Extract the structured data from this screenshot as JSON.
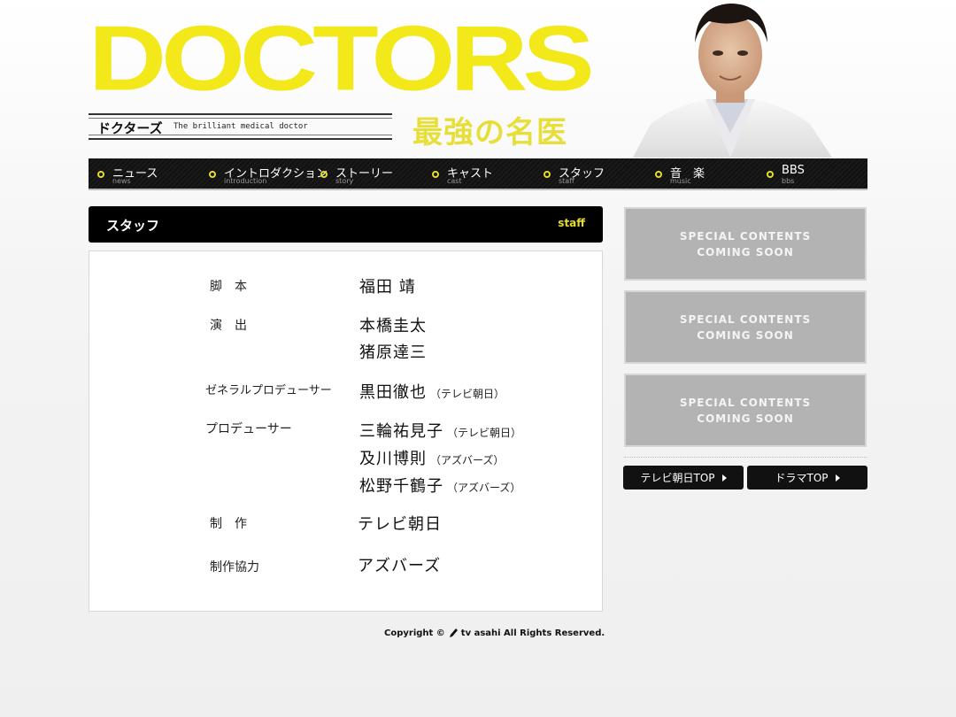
{
  "header": {
    "logo": "DOCTORS",
    "title_jp": "ドクターズ",
    "title_en": "The brilliant medical doctor",
    "subtitle": "最強の名医"
  },
  "nav": [
    {
      "jp": "ニュース",
      "en": "news"
    },
    {
      "jp": "イントロダクション",
      "en": "introduction"
    },
    {
      "jp": "ストーリー",
      "en": "story"
    },
    {
      "jp": "キャスト",
      "en": "cast"
    },
    {
      "jp": "スタッフ",
      "en": "staff"
    },
    {
      "jp": "音　楽",
      "en": "music"
    },
    {
      "jp": "BBS",
      "en": "bbs"
    }
  ],
  "section": {
    "title": "スタッフ",
    "label": "staff"
  },
  "staff": {
    "screenplay": {
      "role": "脚　本",
      "names": [
        "福田 靖"
      ]
    },
    "direction": {
      "role": "演　出",
      "names": [
        "本橋圭太",
        "猪原達三"
      ]
    },
    "general_producer": {
      "role": "ゼネラルプロデューサー",
      "name": "黒田徹也",
      "company": "（テレビ朝日）"
    },
    "producer": {
      "role": "プロデューサー",
      "people": [
        {
          "name": "三輪祐見子",
          "company": "（テレビ朝日）"
        },
        {
          "name": "及川博則",
          "company": "（アズバーズ）"
        },
        {
          "name": "松野千鶴子",
          "company": "（アズバーズ）"
        }
      ]
    },
    "production": {
      "role": "制　作",
      "name": "テレビ朝日"
    },
    "cooperation": {
      "role": "制作協力",
      "name": "アズバーズ"
    }
  },
  "side": {
    "special": [
      {
        "line1": "SPECIAL CONTENTS",
        "line2": "COMING SOON"
      },
      {
        "line1": "SPECIAL CONTENTS",
        "line2": "COMING SOON"
      },
      {
        "line1": "SPECIAL CONTENTS",
        "line2": "COMING SOON"
      }
    ],
    "btn_tvasahi": "テレビ朝日TOP",
    "btn_drama": "ドラマTOP"
  },
  "footer": {
    "prefix": "Copyright ©",
    "suffix": "tv asahi All Rights Reserved."
  }
}
